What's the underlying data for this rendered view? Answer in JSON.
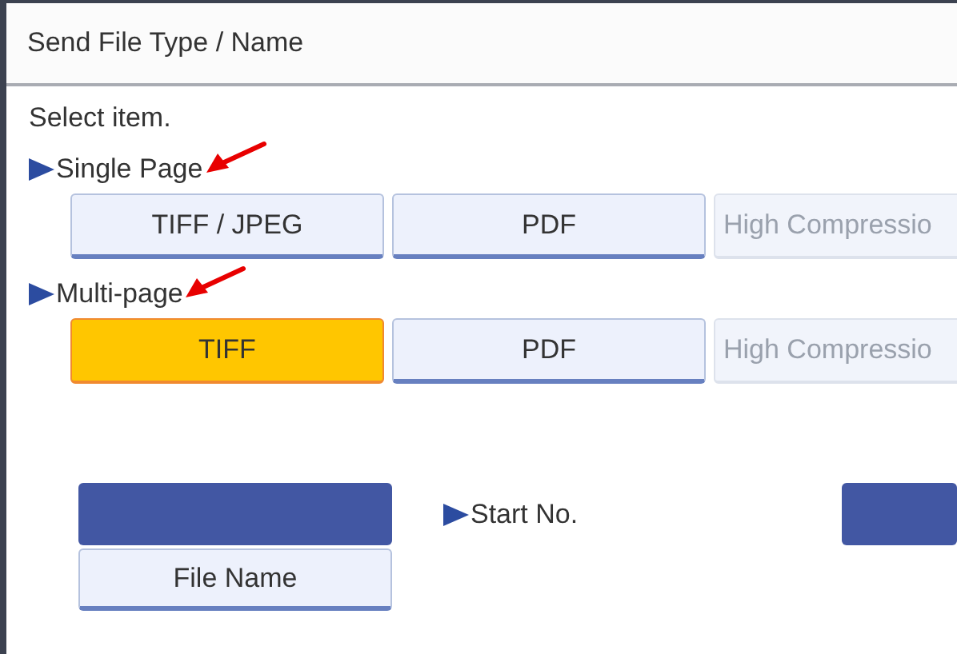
{
  "window": {
    "title": "Send File Type / Name"
  },
  "instruction": "Select item.",
  "sections": [
    {
      "label": "Single Page",
      "annotated": true,
      "options": [
        {
          "label": "TIFF / JPEG",
          "selected": false,
          "disabled": false
        },
        {
          "label": "PDF",
          "selected": false,
          "disabled": false
        },
        {
          "label": "High Compressio",
          "selected": false,
          "disabled": true
        }
      ]
    },
    {
      "label": "Multi-page",
      "annotated": true,
      "options": [
        {
          "label": "TIFF",
          "selected": true,
          "disabled": false
        },
        {
          "label": "PDF",
          "selected": false,
          "disabled": false
        },
        {
          "label": "High Compressio",
          "selected": false,
          "disabled": true
        }
      ]
    }
  ],
  "file_name": {
    "button": "File Name"
  },
  "start_no": {
    "label": "Start No."
  }
}
